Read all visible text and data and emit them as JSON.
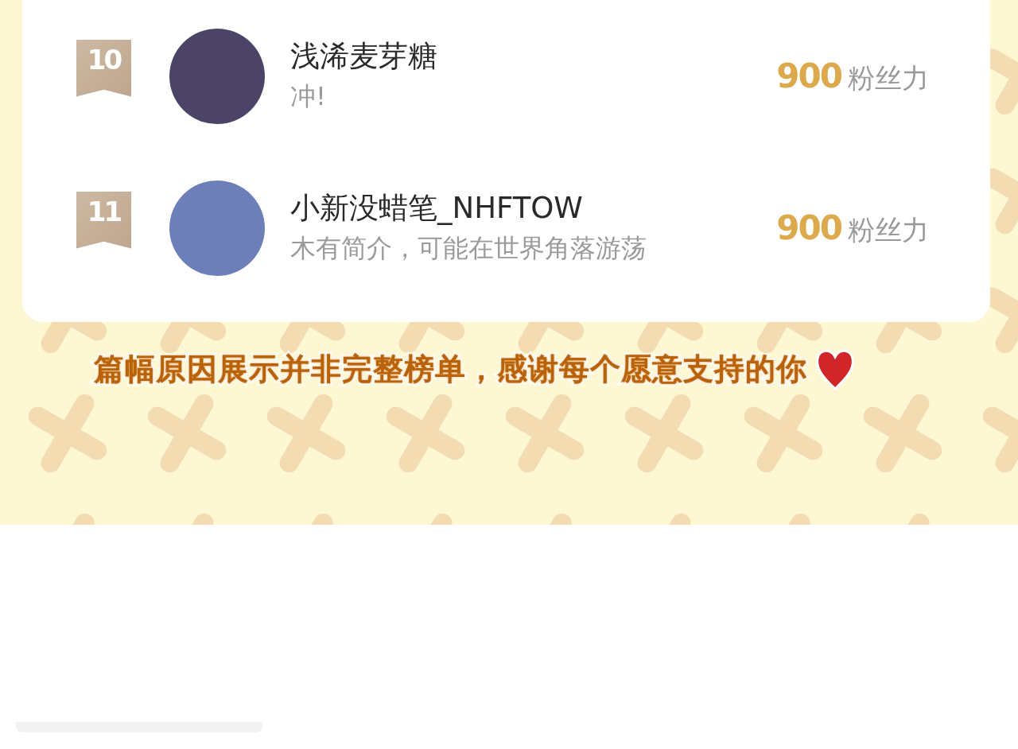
{
  "ranking": [
    {
      "rank": "10",
      "name": "浅浠麦芽糖",
      "bio": "冲!",
      "score": "900",
      "score_unit": "粉丝力"
    },
    {
      "rank": "11",
      "name": "小新没蜡笔_NHFTOW",
      "bio": "木有简介，可能在世界角落游荡",
      "score": "900",
      "score_unit": "粉丝力"
    }
  ],
  "footer_note": "篇幅原因展示并非完整榜单，感谢每个愿意支持的你"
}
